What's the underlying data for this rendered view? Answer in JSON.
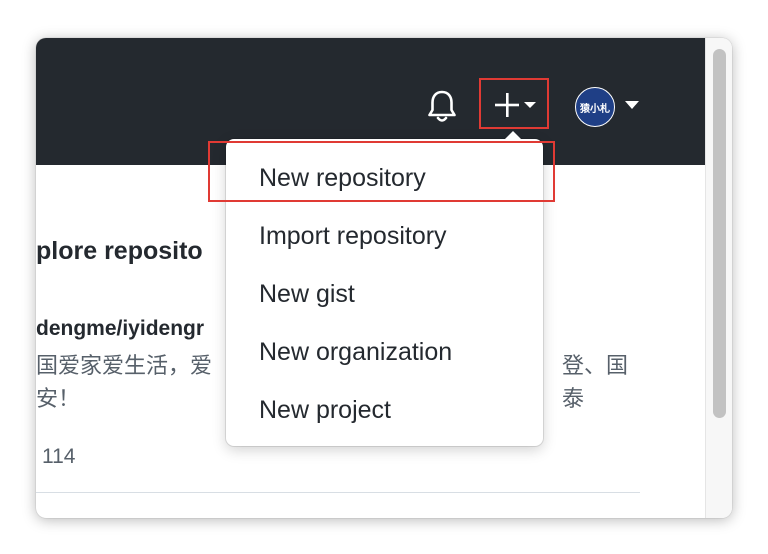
{
  "header": {
    "notification_icon": "bell-icon",
    "create_icon": "plus-icon",
    "avatar_text": "猿小札"
  },
  "main": {
    "section_title": "plore reposito",
    "repo": {
      "name": "dengme/iyidengr",
      "description_line1_left": "国爱家爱生活，爱",
      "description_line1_right": "登、国泰",
      "description_line2": "安！",
      "stars": "114"
    }
  },
  "dropdown": {
    "items": [
      {
        "label": "New repository"
      },
      {
        "label": "Import repository"
      },
      {
        "label": "New gist"
      },
      {
        "label": "New organization"
      },
      {
        "label": "New project"
      }
    ]
  },
  "colors": {
    "header_bg": "#24292f",
    "highlight": "#e03a34",
    "avatar_bg": "#1f3f86"
  }
}
